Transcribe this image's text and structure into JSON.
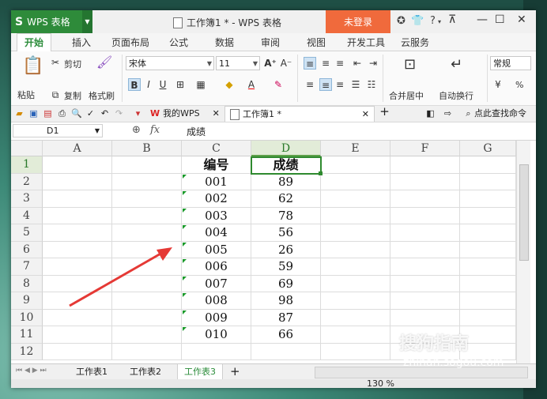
{
  "app": {
    "logo": "S",
    "name": "WPS 表格",
    "window_title": "工作簿1 * - WPS 表格",
    "login_button": "未登录"
  },
  "ribbon_tabs": [
    "开始",
    "插入",
    "页面布局",
    "公式",
    "数据",
    "审阅",
    "视图",
    "开发工具",
    "云服务"
  ],
  "ribbon": {
    "paste": "粘贴",
    "cut": "剪切",
    "copy": "复制",
    "format_painter": "格式刷",
    "font_name": "宋体",
    "font_size": "11",
    "merge_center": "合并居中",
    "auto_wrap": "自动换行",
    "number_format": "常规",
    "percent": "%"
  },
  "quick_access": {
    "my_wps_tab": "我的WPS",
    "doc_tab": "工作簿1 *",
    "search_label": "点此查找命令"
  },
  "formula_bar": {
    "name_box": "D1",
    "fx_label": "fx",
    "content": "成绩"
  },
  "columns": [
    "A",
    "B",
    "C",
    "D",
    "E",
    "F",
    "G"
  ],
  "rows": [
    "1",
    "2",
    "3",
    "4",
    "5",
    "6",
    "7",
    "8",
    "9",
    "10",
    "11",
    "12"
  ],
  "table": {
    "header": [
      "编号",
      "成绩"
    ],
    "data": [
      [
        "001",
        "89"
      ],
      [
        "002",
        "62"
      ],
      [
        "003",
        "78"
      ],
      [
        "004",
        "56"
      ],
      [
        "005",
        "26"
      ],
      [
        "006",
        "59"
      ],
      [
        "007",
        "69"
      ],
      [
        "008",
        "98"
      ],
      [
        "009",
        "87"
      ],
      [
        "010",
        "66"
      ]
    ]
  },
  "sheets": [
    "工作表1",
    "工作表2",
    "工作表3"
  ],
  "active_sheet": "工作表3",
  "status": {
    "zoom": "130 %"
  },
  "watermark": {
    "brand": "搜狗指南",
    "url": "zhinan.sogou.com"
  },
  "colors": {
    "wps_green": "#2e8b3a",
    "login_orange": "#f06a3c",
    "annotation_arrow": "#e53935"
  }
}
